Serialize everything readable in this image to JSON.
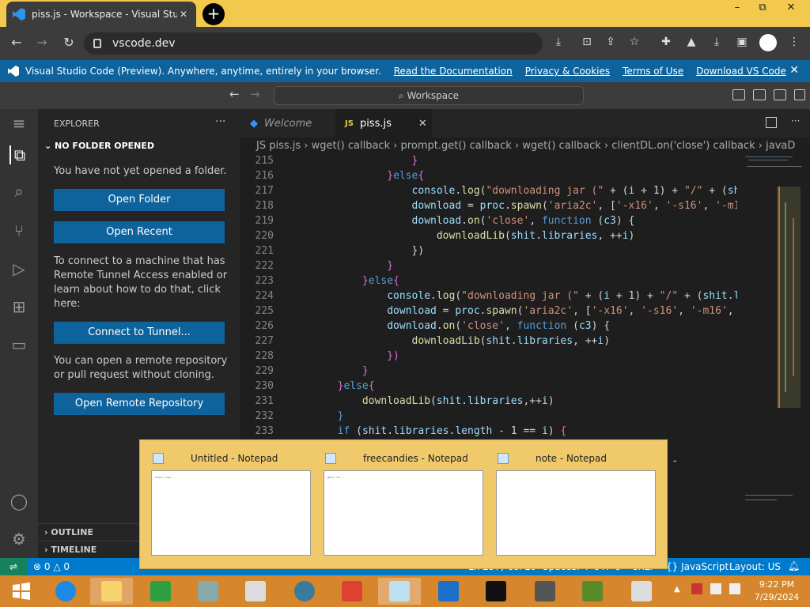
{
  "browser": {
    "tab_title": "piss.js - Workspace - Visual Studi",
    "new_tab_label": "+",
    "url": "vscode.dev",
    "window_controls": [
      "–",
      "⧉",
      "✕"
    ]
  },
  "banner": {
    "text": "Visual Studio Code (Preview). Anywhere, anytime, entirely in your browser.",
    "links": [
      "Read the Documentation",
      "Privacy & Cookies",
      "Terms of Use",
      "Download VS Code"
    ]
  },
  "workbench": {
    "command_center": "Workspace"
  },
  "sidebar": {
    "title": "EXPLORER",
    "section": "NO FOLDER OPENED",
    "no_folder_text": "You have not yet opened a folder.",
    "open_folder": "Open Folder",
    "open_recent": "Open Recent",
    "tunnel_text": "To connect to a machine that has Remote Tunnel Access enabled or learn about how to do that, click here:",
    "connect_tunnel": "Connect to Tunnel...",
    "remote_text": "You can open a remote repository or pull request without cloning.",
    "open_remote": "Open Remote Repository",
    "outline": "OUTLINE",
    "timeline": "TIMELINE"
  },
  "editor": {
    "tabs": [
      {
        "label": "Welcome"
      },
      {
        "label": "piss.js",
        "badge": "JS"
      }
    ],
    "breadcrumb": "JS piss.js  ›  wget() callback  ›  prompt.get() callback  ›  wget() callback  ›  clientDL.on('close') callback  ›  javaD",
    "line_numbers": [
      "215",
      "216",
      "217",
      "218",
      "219",
      "220",
      "221",
      "222",
      "223",
      "224",
      "225",
      "226",
      "227",
      "228",
      "229",
      "230",
      "231",
      "232",
      "233"
    ]
  },
  "statusbar": {
    "errors": "0",
    "warnings": "0",
    "position": "Ln 237, Col 29",
    "spaces": "Spaces: 4",
    "encoding": "UTF-8",
    "eol": "CRLF",
    "language": "JavaScript",
    "layout": "Layout: US"
  },
  "notepad_previews": [
    {
      "title": "Untitled - Notepad",
      "preview": "https://www..."
    },
    {
      "title": "freecandies - Notepad",
      "preview": "@echo off ..."
    },
    {
      "title": "note - Notepad",
      "preview": "..."
    }
  ],
  "taskbar": {
    "time": "9:22 PM",
    "date": "7/29/2024"
  }
}
